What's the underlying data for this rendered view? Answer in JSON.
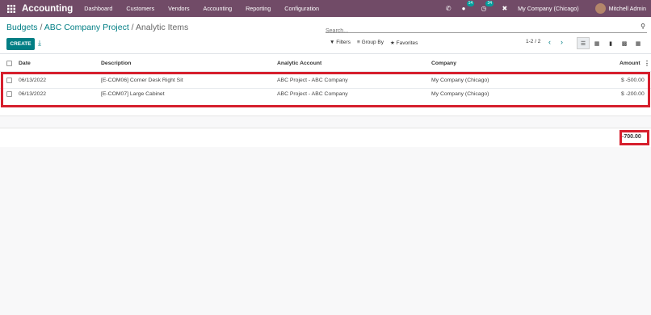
{
  "navbar": {
    "app_title": "Accounting",
    "menu": [
      "Dashboard",
      "Customers",
      "Vendors",
      "Accounting",
      "Reporting",
      "Configuration"
    ],
    "messages_badge": "14",
    "activities_badge": "34",
    "company": "My Company (Chicago)",
    "user": "Mitchell Admin"
  },
  "breadcrumb": {
    "part1": "Budgets",
    "sep1": " / ",
    "part2": "ABC Company Project",
    "sep2": " / ",
    "current": "Analytic Items"
  },
  "search": {
    "placeholder": "Search..."
  },
  "toolbar": {
    "create_label": "CREATE",
    "filters_label": "Filters",
    "groupby_label": "Group By",
    "favorites_label": "Favorites",
    "pager": "1-2 / 2"
  },
  "table": {
    "columns": [
      "Date",
      "Description",
      "Analytic Account",
      "Company",
      "Amount"
    ],
    "rows": [
      {
        "date": "06/13/2022",
        "description": "[E-COM06] Corner Desk Right Sit",
        "account": "ABC Project - ABC Company",
        "company": "My Company (Chicago)",
        "amount": "$ -500.00"
      },
      {
        "date": "06/13/2022",
        "description": "[E-COM07] Large Cabinet",
        "account": "ABC Project - ABC Company",
        "company": "My Company (Chicago)",
        "amount": "$ -200.00"
      }
    ],
    "total": "-700.00"
  },
  "colors": {
    "navbar": "#714b67",
    "accent": "#017e84",
    "highlight": "#d61f2d"
  }
}
